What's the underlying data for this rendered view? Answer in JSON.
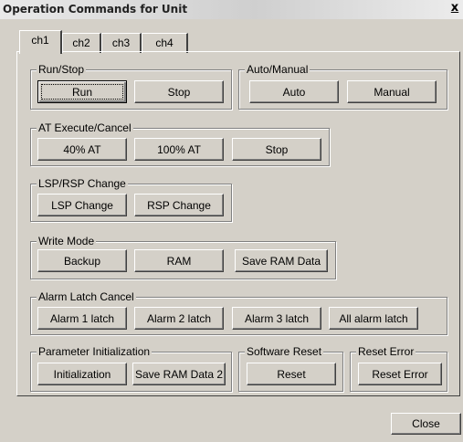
{
  "window": {
    "title": "Operation Commands for Unit",
    "close_glyph": "x"
  },
  "tabs": [
    {
      "label": "ch1"
    },
    {
      "label": "ch2"
    },
    {
      "label": "ch3"
    },
    {
      "label": "ch4"
    }
  ],
  "groups": {
    "run_stop": {
      "title": "Run/Stop",
      "run": "Run",
      "stop": "Stop"
    },
    "auto_manual": {
      "title": "Auto/Manual",
      "auto": "Auto",
      "manual": "Manual"
    },
    "at_execute": {
      "title": "AT Execute/Cancel",
      "at40": "40% AT",
      "at100": "100% AT",
      "stop": "Stop"
    },
    "lsp_rsp": {
      "title": "LSP/RSP Change",
      "lsp": "LSP Change",
      "rsp": "RSP Change"
    },
    "write_mode": {
      "title": "Write Mode",
      "backup": "Backup",
      "ram": "RAM",
      "save": "Save RAM Data"
    },
    "alarm_latch": {
      "title": "Alarm Latch Cancel",
      "alarm1": "Alarm 1 latch",
      "alarm2": "Alarm 2 latch",
      "alarm3": "Alarm 3 latch",
      "all": "All alarm latch"
    },
    "param_init": {
      "title": "Parameter Initialization",
      "init": "Initialization",
      "save2": "Save RAM Data 2"
    },
    "software_reset": {
      "title": "Software Reset",
      "reset": "Reset"
    },
    "reset_error": {
      "title": "Reset Error",
      "reset_error": "Reset Error"
    }
  },
  "footer": {
    "close": "Close"
  }
}
